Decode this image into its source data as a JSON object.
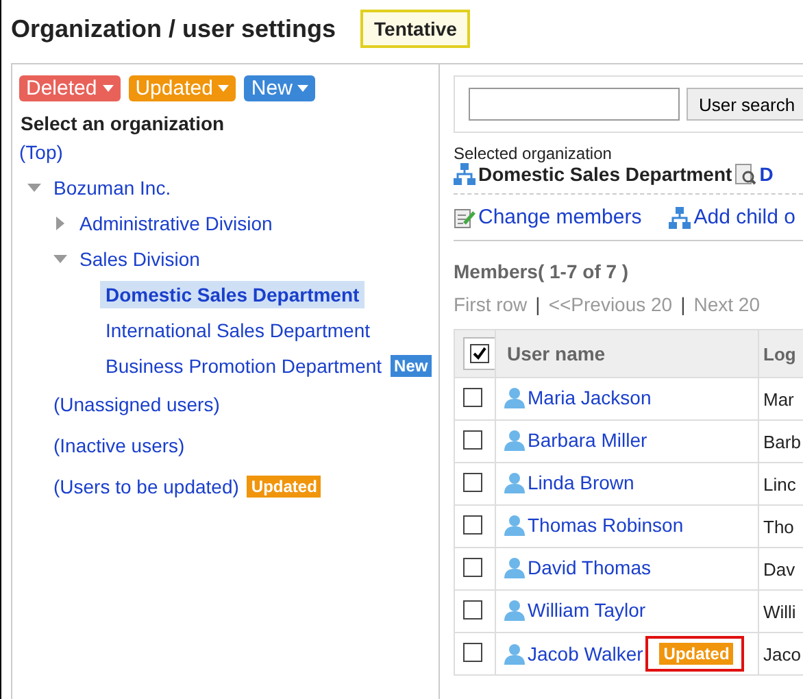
{
  "title": "Organization / user settings",
  "status_badge": "Tentative",
  "filters": [
    {
      "label": "Deleted",
      "kind": "deleted"
    },
    {
      "label": "Updated",
      "kind": "updated"
    },
    {
      "label": "New",
      "kind": "new"
    }
  ],
  "tree_heading": "Select an organization",
  "top_link": "(Top)",
  "tree": [
    {
      "label": "Bozuman Inc.",
      "expanded": true,
      "selected": false,
      "children": [
        {
          "label": "Administrative Division",
          "expanded": false,
          "selected": false
        },
        {
          "label": "Sales Division",
          "expanded": true,
          "selected": false,
          "children": [
            {
              "label": "Domestic Sales Department",
              "selected": true
            },
            {
              "label": "International Sales Department",
              "selected": false
            },
            {
              "label": "Business Promotion Department",
              "selected": false,
              "badge": {
                "label": "New",
                "kind": "new"
              }
            }
          ]
        }
      ]
    }
  ],
  "other_items": [
    {
      "label": "(Unassigned users)"
    },
    {
      "label": "(Inactive users)"
    },
    {
      "label": "(Users to be updated)",
      "badge": {
        "label": "Updated",
        "kind": "updated"
      }
    }
  ],
  "search": {
    "button": "User search"
  },
  "selected_org": {
    "caption": "Selected organization",
    "name": "Domestic Sales Department",
    "link": "D"
  },
  "actions": [
    {
      "label": "Change members",
      "kind": "edit"
    },
    {
      "label": "Add child o",
      "kind": "org"
    }
  ],
  "members_heading": "Members( 1-7 of 7 )",
  "pager": {
    "separator": "|",
    "links": [
      "First row",
      "<<Previous 20",
      "Next 20"
    ]
  },
  "table": {
    "columns": [
      "User name",
      "Log"
    ],
    "header_checked": true,
    "rows": [
      {
        "name": "Maria Jackson",
        "login": "Mar",
        "checked": false
      },
      {
        "name": "Barbara Miller",
        "login": "Barb",
        "checked": false
      },
      {
        "name": "Linda Brown",
        "login": "Linc",
        "checked": false
      },
      {
        "name": "Thomas Robinson",
        "login": "Tho",
        "checked": false
      },
      {
        "name": "David Thomas",
        "login": "Dav",
        "checked": false
      },
      {
        "name": "William Taylor",
        "login": "Willi",
        "checked": false
      },
      {
        "name": "Jacob Walker",
        "login": "Jaco",
        "checked": false,
        "badge": {
          "label": "Updated",
          "kind": "updated",
          "callout": true
        }
      }
    ]
  }
}
